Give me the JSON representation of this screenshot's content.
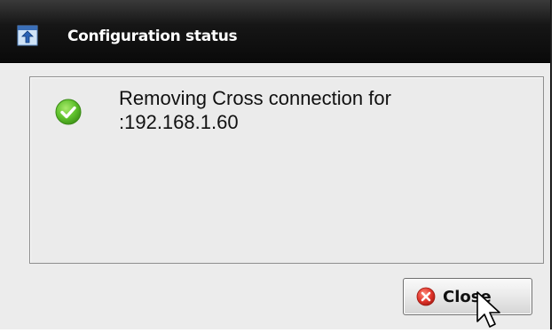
{
  "window": {
    "title": "Configuration status",
    "icon": "app-upload-icon"
  },
  "message": {
    "status_icon": "success-check-icon",
    "line1": "Removing Cross connection for",
    "line2": ":192.168.1.60"
  },
  "actions": {
    "close_label": "Close",
    "close_icon": "close-x-icon"
  },
  "colors": {
    "titlebar": "#0a0a0a",
    "success_green": "#5cbf2a",
    "close_red": "#e0342b",
    "panel_bg": "#ebebeb"
  }
}
